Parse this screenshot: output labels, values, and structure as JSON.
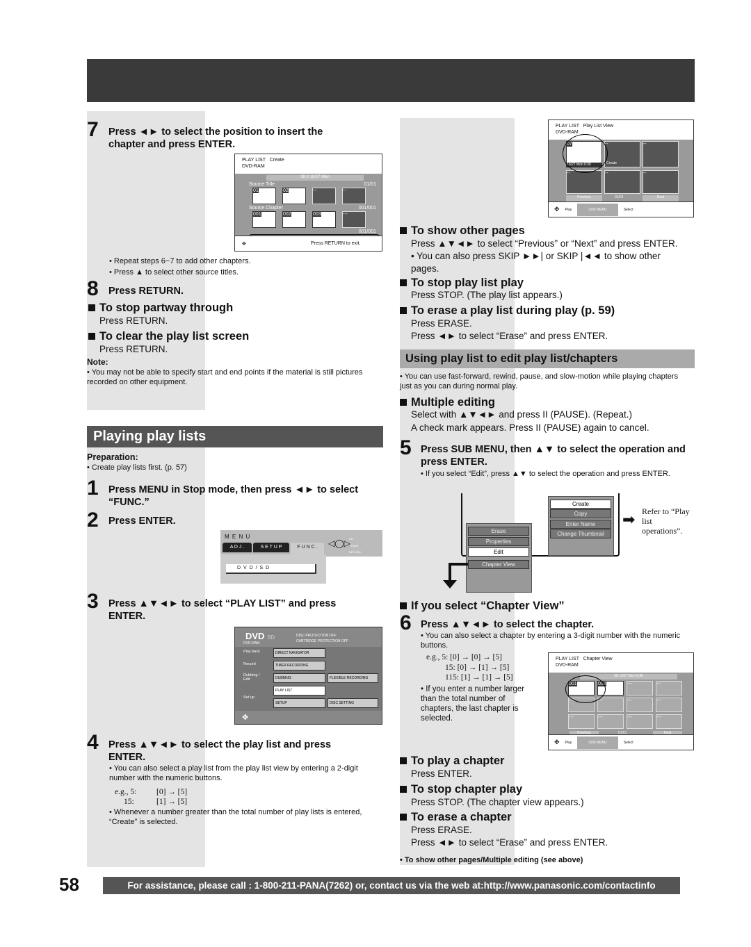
{
  "page_number": "58",
  "footer": "For assistance, please call : 1-800-211-PANA(7262) or, contact us via the web at:http://www.panasonic.com/contactinfo",
  "left": {
    "step7_num": "7",
    "step7": "Press ◄► to select the position to insert the chapter and press ENTER.",
    "screen1": {
      "title": "PLAY LIST",
      "mode": "Create",
      "disc": "DVD-RAM",
      "info": "08    0  10/27  Mon",
      "source_title": "Source Title",
      "source_title_page": "01/01",
      "source_chapter": "Source Chapter",
      "source_chapter_page": "001/001",
      "playlist_chapter_page": "001/001",
      "thumbs1": [
        "01",
        "02",
        "--",
        "--"
      ],
      "thumbs2": [
        "001",
        "002",
        "003",
        "---"
      ],
      "thumbs3": [
        "---",
        "---",
        "---",
        "---"
      ],
      "hint": "Press RETURN to exit."
    },
    "bullets7": [
      "• Repeat steps 6~7 to add other chapters.",
      "• Press ▲ to select other source titles."
    ],
    "step8_num": "8",
    "step8": "Press RETURN.",
    "stop_partway": "To stop partway through",
    "stop_partway_text": "Press RETURN.",
    "clear_screen": "To clear the play list screen",
    "clear_screen_text": "Press RETURN.",
    "note_label": "Note:",
    "note": "• You may not be able to specify start and end points if the material is still pictures recorded on other equipment.",
    "section_title": "Playing play lists",
    "prep_label": "Preparation:",
    "prep": "• Create play lists first. (p. 57)",
    "step1_num": "1",
    "step1": "Press MENU in Stop mode, then press ◄► to select “FUNC.”",
    "step2_num": "2",
    "step2": "Press ENTER.",
    "menu_screen": {
      "title": "M E N U",
      "tabs": [
        "A D J .",
        "S E T   U P",
        "F U N C ."
      ],
      "item": "D V D / S D",
      "keys": [
        "OK",
        "PAGE",
        "RETURN"
      ]
    },
    "step3_num": "3",
    "step3": "Press ▲▼◄► to select “PLAY LIST” and press ENTER.",
    "dvd_screen": {
      "logo": "DVD",
      "logo_sub": "SD",
      "disc": "DVD-RAM",
      "status1": "DISC PROTECTION  OFF",
      "status2": "CARTRIDGE PROTECTION  OFF",
      "categories": [
        "Play back",
        "Record",
        "Dubbing / Edit",
        "Set up"
      ],
      "buttons": [
        "DIRECT NAVIGATOR",
        "TIMER RECORDING",
        "DUBBING",
        "FLEXIBLE RECORDING",
        "PLAY LIST",
        "SETUP",
        "DISC SETTING"
      ]
    },
    "step4_num": "4",
    "step4": "Press ▲▼◄► to select the play list and press ENTER.",
    "bullet4": "• You can also select a play list from the play list view by entering a 2-digit number with the numeric buttons.",
    "eg": [
      "e.g.,  5:",
      "[0]  →  [5]",
      "15:",
      "[1]  →  [5]"
    ],
    "bullet4b": "• Whenever a number greater than the total number of play lists is entered, “Create” is selected."
  },
  "right": {
    "screen2": {
      "title": "PLAY LIST",
      "mode": "Play List View",
      "disc": "DVD-RAM",
      "thumbs": [
        "07",
        "--",
        "--",
        "--",
        "--",
        "--"
      ],
      "date": "10/27  Mon  0:30",
      "create": "Create",
      "prev": "Previous",
      "page": "01/01",
      "next": "Next",
      "play": "Play",
      "submenu": "SUB MENU",
      "select": "Select"
    },
    "other_pages": "To show other pages",
    "other_pages_text": "Press ▲▼◄► to select “Previous” or “Next” and press ENTER.",
    "other_pages_bullet": "• You can also press SKIP ►►| or SKIP |◄◄ to show other pages.",
    "stop_play": "To stop play list play",
    "stop_play_text": "Press STOP. (The play list appears.)",
    "erase_play": "To erase a play list during play (p. 59)",
    "erase_play_text1": "Press ERASE.",
    "erase_play_text2": "Press ◄► to select “Erase” and press ENTER.",
    "section_title": "Using play list to edit play list/chapters",
    "section_bullet": "• You can use fast-forward, rewind, pause, and slow-motion while playing chapters just as you can during normal play.",
    "multi": "Multiple editing",
    "multi_text1": "Select with ▲▼◄► and press II (PAUSE). (Repeat.)",
    "multi_text2": "A check mark appears. Press II (PAUSE) again to cancel.",
    "step5_num": "5",
    "step5": "Press SUB MENU, then ▲▼ to select the operation and press ENTER.",
    "bullet5": "• If you select “Edit”, press ▲▼ to select the operation and press ENTER.",
    "submenu1": [
      "Erase",
      "Properties",
      "Edit",
      "Chapter View"
    ],
    "submenu2": [
      "Create",
      "Copy",
      "Enter Name",
      "Change Thumbnail"
    ],
    "refer": "Refer to “Play list operations”.",
    "chapter_view": "If you select “Chapter View”",
    "step6_num": "6",
    "step6": "Press ▲▼◄► to select the chapter.",
    "bullet6": "• You can also select a chapter by entering a 3-digit number with the numeric buttons.",
    "eg": [
      "e.g.,  5:   [0] → [0] → [5]",
      "15:   [0] → [1] → [5]",
      "115:  [1] → [1] → [5]"
    ],
    "bullet6b": "• If you enter a number larger than the total number of chapters, the last chapter is selected.",
    "screen3": {
      "title": "PLAY LIST",
      "mode": "Chapter View",
      "disc": "DVD-RAM",
      "info": "08    10/27  Mon  0:30",
      "thumbs": [
        "001",
        "002",
        "---",
        "---",
        "---",
        "---",
        "---",
        "---",
        "---",
        "---",
        "---",
        "---"
      ],
      "prev": "Previous",
      "page": "01/01",
      "next": "Next",
      "play": "Play",
      "submenu": "SUB MENU",
      "select": "Select"
    },
    "play_chapter": "To play a chapter",
    "play_chapter_text": "Press ENTER.",
    "stop_chapter": "To stop chapter play",
    "stop_chapter_text": "Press STOP. (The chapter view appears.)",
    "erase_chapter": "To erase a chapter",
    "erase_chapter_text1": "Press ERASE.",
    "erase_chapter_text2": "Press ◄► to select “Erase” and press ENTER.",
    "footnote": "• To show other pages/Multiple editing (see above)"
  }
}
